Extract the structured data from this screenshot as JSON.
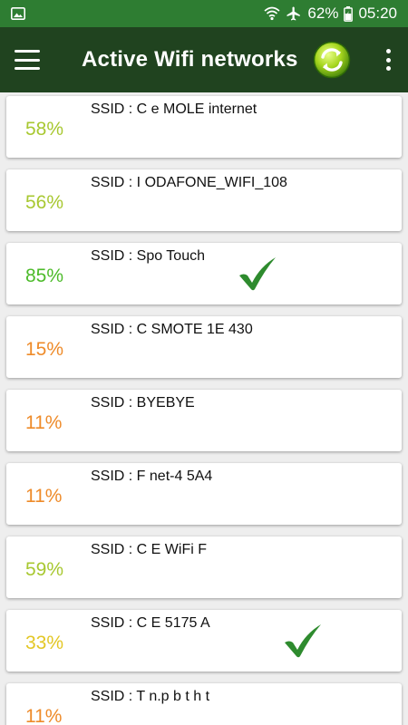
{
  "status_bar": {
    "battery": "62%",
    "time": "05:20"
  },
  "app_bar": {
    "title": "Active Wifi networks"
  },
  "icons": {
    "menu": "hamburger-menu-icon",
    "refresh": "refresh-icon",
    "overflow": "overflow-menu-icon",
    "check": "check-icon"
  },
  "colors": {
    "status_bar": "#2e7d32",
    "app_bar": "#20431f",
    "check": "#2e8b2e"
  },
  "networks": [
    {
      "percent": "58%",
      "ssid": "SSID : C  e  MOLE internet",
      "color": "#a8c831",
      "connected": false
    },
    {
      "percent": "56%",
      "ssid": "SSID : I  ODAFONE_WIFI_108",
      "color": "#a8c831",
      "connected": false
    },
    {
      "percent": "85%",
      "ssid": "SSID : Spo   Touch",
      "color": "#4cbb2a",
      "connected": true
    },
    {
      "percent": "15%",
      "ssid": "SSID : C  SMOTE  1E  430",
      "color": "#ee8b2a",
      "connected": false
    },
    {
      "percent": "11%",
      "ssid": "SSID : BYEBYE",
      "color": "#ee8b2a",
      "connected": false
    },
    {
      "percent": "11%",
      "ssid": "SSID : F   net-4  5A4",
      "color": "#ee8b2a",
      "connected": false
    },
    {
      "percent": "59%",
      "ssid": "SSID : C  E WiFi F  ",
      "color": "#a8c831",
      "connected": false
    },
    {
      "percent": "33%",
      "ssid": "SSID : C     E  5175  A",
      "color": "#e3c725",
      "connected": true
    },
    {
      "percent": "11%",
      "ssid": "SSID : T   n.p    b  t  h  t",
      "color": "#ee8b2a",
      "connected": false
    }
  ]
}
